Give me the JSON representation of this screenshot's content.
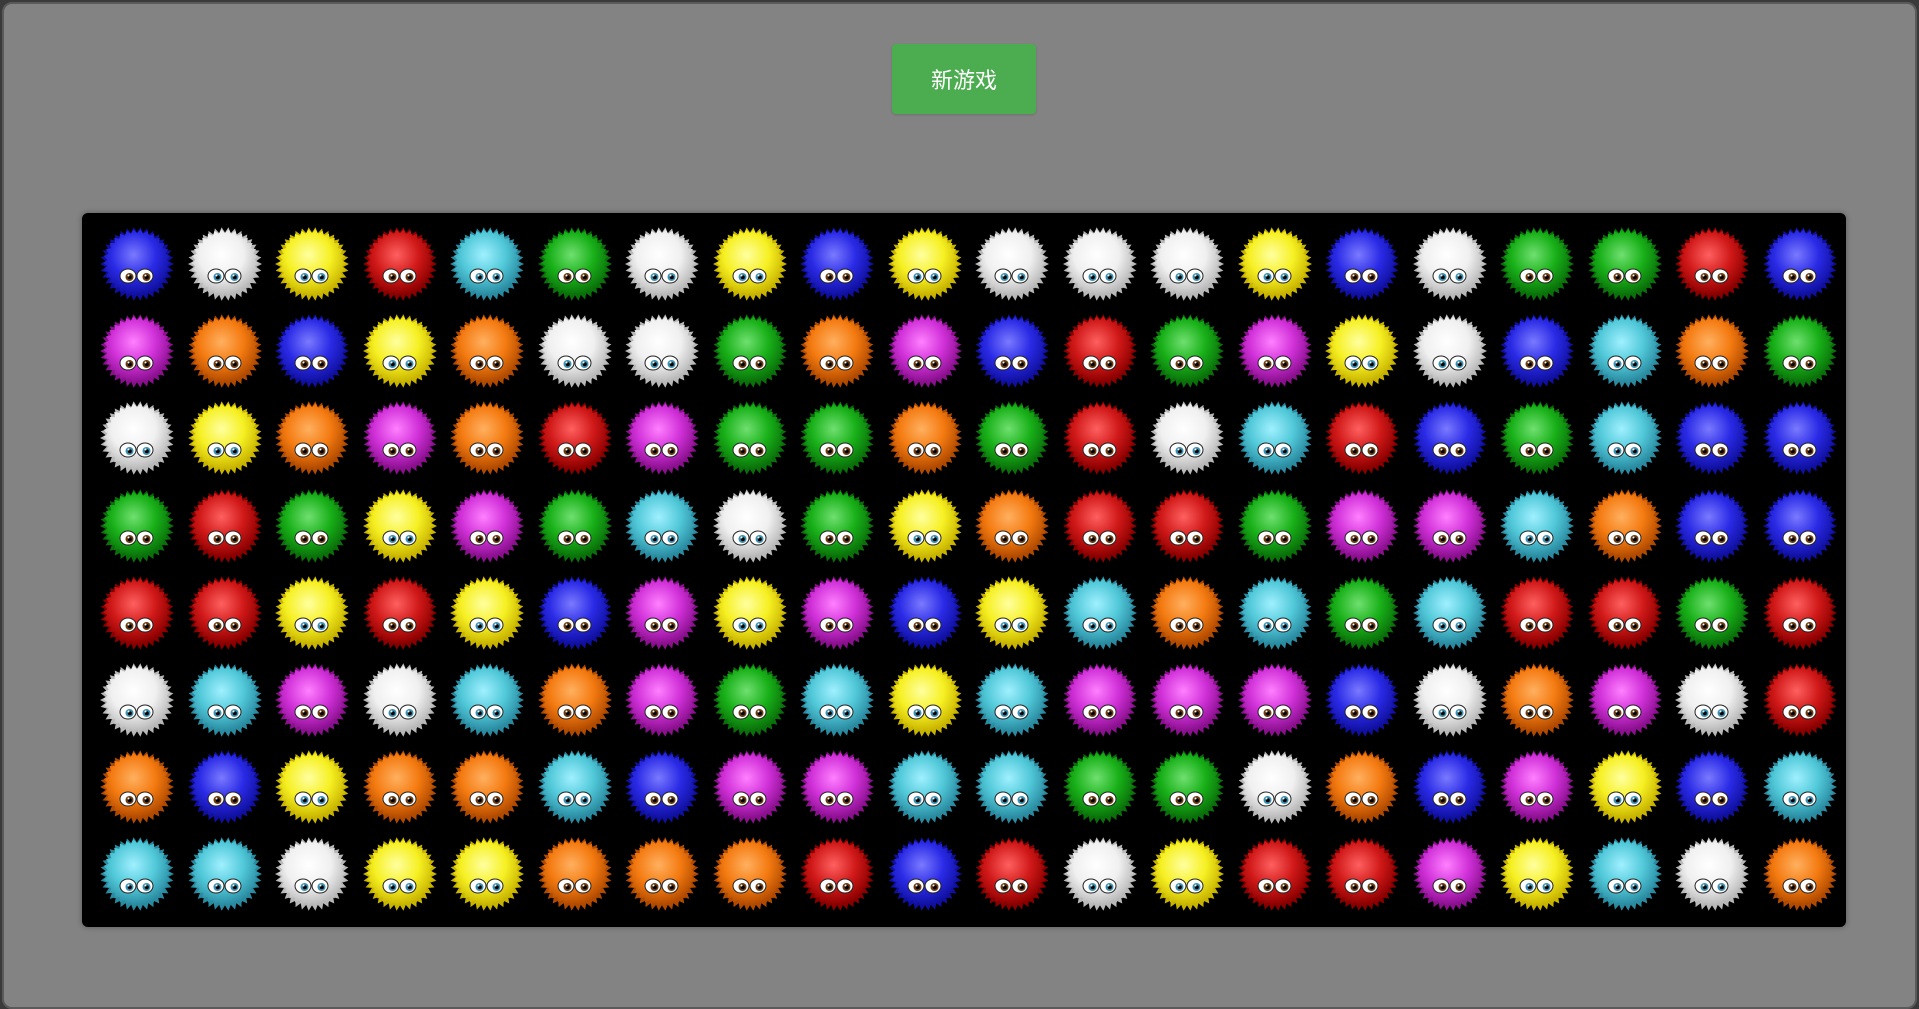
{
  "toolbar": {
    "new_game_label": "新游戏"
  },
  "palette": {
    "blue": {
      "main": "#2a2ae6",
      "dark": "#1010a0",
      "light": "#7a7aff"
    },
    "white": {
      "main": "#f0f0f0",
      "dark": "#b8b8b8",
      "light": "#ffffff"
    },
    "yellow": {
      "main": "#f6f022",
      "dark": "#c8b400",
      "light": "#ffffa0"
    },
    "red": {
      "main": "#d01818",
      "dark": "#8a0000",
      "light": "#ff6060"
    },
    "cyan": {
      "main": "#50c8d8",
      "dark": "#2a8aa0",
      "light": "#a0f0ff"
    },
    "green": {
      "main": "#18b018",
      "dark": "#0a700a",
      "light": "#70e070"
    },
    "magenta": {
      "main": "#d030d8",
      "dark": "#8a108e",
      "light": "#ff80ff"
    },
    "orange": {
      "main": "#f47a10",
      "dark": "#b04a00",
      "light": "#ffb060"
    }
  },
  "board": {
    "rows": 8,
    "cols": 20,
    "grid": [
      [
        "blue",
        "white",
        "yellow",
        "red",
        "cyan",
        "green",
        "white",
        "yellow",
        "blue",
        "yellow",
        "white",
        "white",
        "white",
        "yellow",
        "blue",
        "white",
        "green",
        "green",
        "red",
        "blue"
      ],
      [
        "magenta",
        "orange",
        "blue",
        "yellow",
        "orange",
        "white",
        "white",
        "green",
        "orange",
        "magenta",
        "blue",
        "red",
        "green",
        "magenta",
        "yellow",
        "white",
        "blue",
        "cyan",
        "orange",
        "green"
      ],
      [
        "white",
        "yellow",
        "orange",
        "magenta",
        "orange",
        "red",
        "magenta",
        "green",
        "green",
        "orange",
        "green",
        "red",
        "white",
        "cyan",
        "red",
        "blue",
        "green",
        "cyan",
        "blue",
        "blue"
      ],
      [
        "green",
        "red",
        "green",
        "yellow",
        "magenta",
        "green",
        "cyan",
        "white",
        "green",
        "yellow",
        "orange",
        "red",
        "red",
        "green",
        "magenta",
        "magenta",
        "cyan",
        "orange",
        "blue",
        "blue"
      ],
      [
        "red",
        "red",
        "yellow",
        "red",
        "yellow",
        "blue",
        "magenta",
        "yellow",
        "magenta",
        "blue",
        "yellow",
        "cyan",
        "orange",
        "cyan",
        "green",
        "cyan",
        "red",
        "red",
        "green",
        "red"
      ],
      [
        "white",
        "cyan",
        "magenta",
        "white",
        "cyan",
        "orange",
        "magenta",
        "green",
        "cyan",
        "yellow",
        "cyan",
        "magenta",
        "magenta",
        "magenta",
        "blue",
        "white",
        "orange",
        "magenta",
        "white",
        "red"
      ],
      [
        "orange",
        "blue",
        "yellow",
        "orange",
        "orange",
        "cyan",
        "blue",
        "magenta",
        "magenta",
        "cyan",
        "cyan",
        "green",
        "green",
        "white",
        "orange",
        "blue",
        "magenta",
        "yellow",
        "blue",
        "cyan"
      ],
      [
        "cyan",
        "cyan",
        "white",
        "yellow",
        "yellow",
        "orange",
        "orange",
        "orange",
        "red",
        "blue",
        "red",
        "white",
        "yellow",
        "red",
        "red",
        "magenta",
        "yellow",
        "cyan",
        "white",
        "orange"
      ]
    ]
  }
}
